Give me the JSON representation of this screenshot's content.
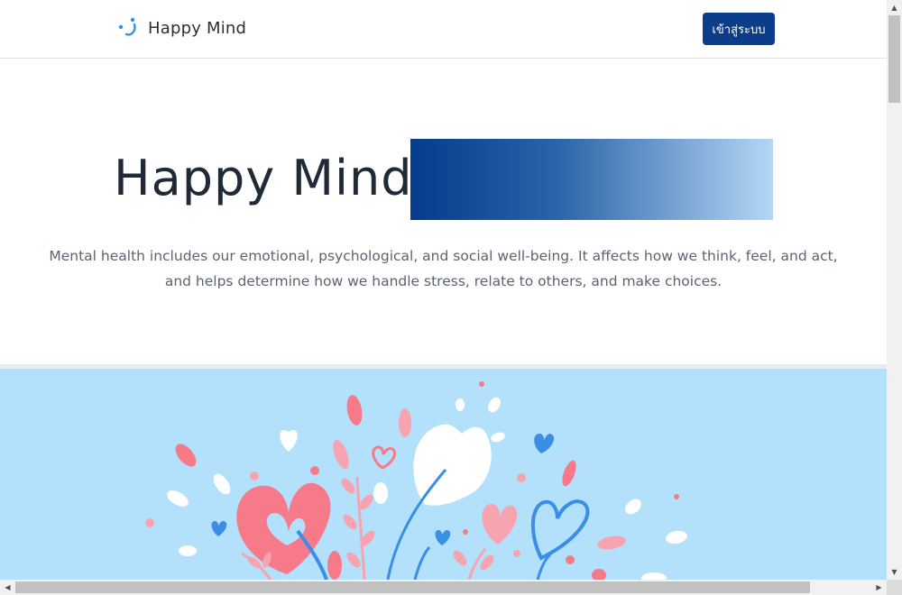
{
  "navbar": {
    "brand_name": "Happy Mind",
    "login_label": "เข้าสู่ระบบ",
    "brand_icon": "smile-logo-icon"
  },
  "hero": {
    "title": "Happy Mind",
    "description_line1": "Mental health includes our emotional, psychological, and social well-being. It affects how we think, feel, and act,",
    "description_line2": "and helps determine how we handle stress, relate to others, and make choices."
  },
  "illustration": {
    "name": "hearts-and-flowers-illustration"
  },
  "colors": {
    "primary": "#0b3d8a",
    "illustration_bg": "#b3e0fb",
    "heart_pink": "#f67a8a",
    "light_pink": "#f8a3b0",
    "leaf_blue": "#3a8ee6",
    "white": "#ffffff"
  },
  "scrollbars": {
    "vertical_icon_up": "▲",
    "vertical_icon_down": "▼",
    "horizontal_icon_left": "◀",
    "horizontal_icon_right": "▶"
  }
}
